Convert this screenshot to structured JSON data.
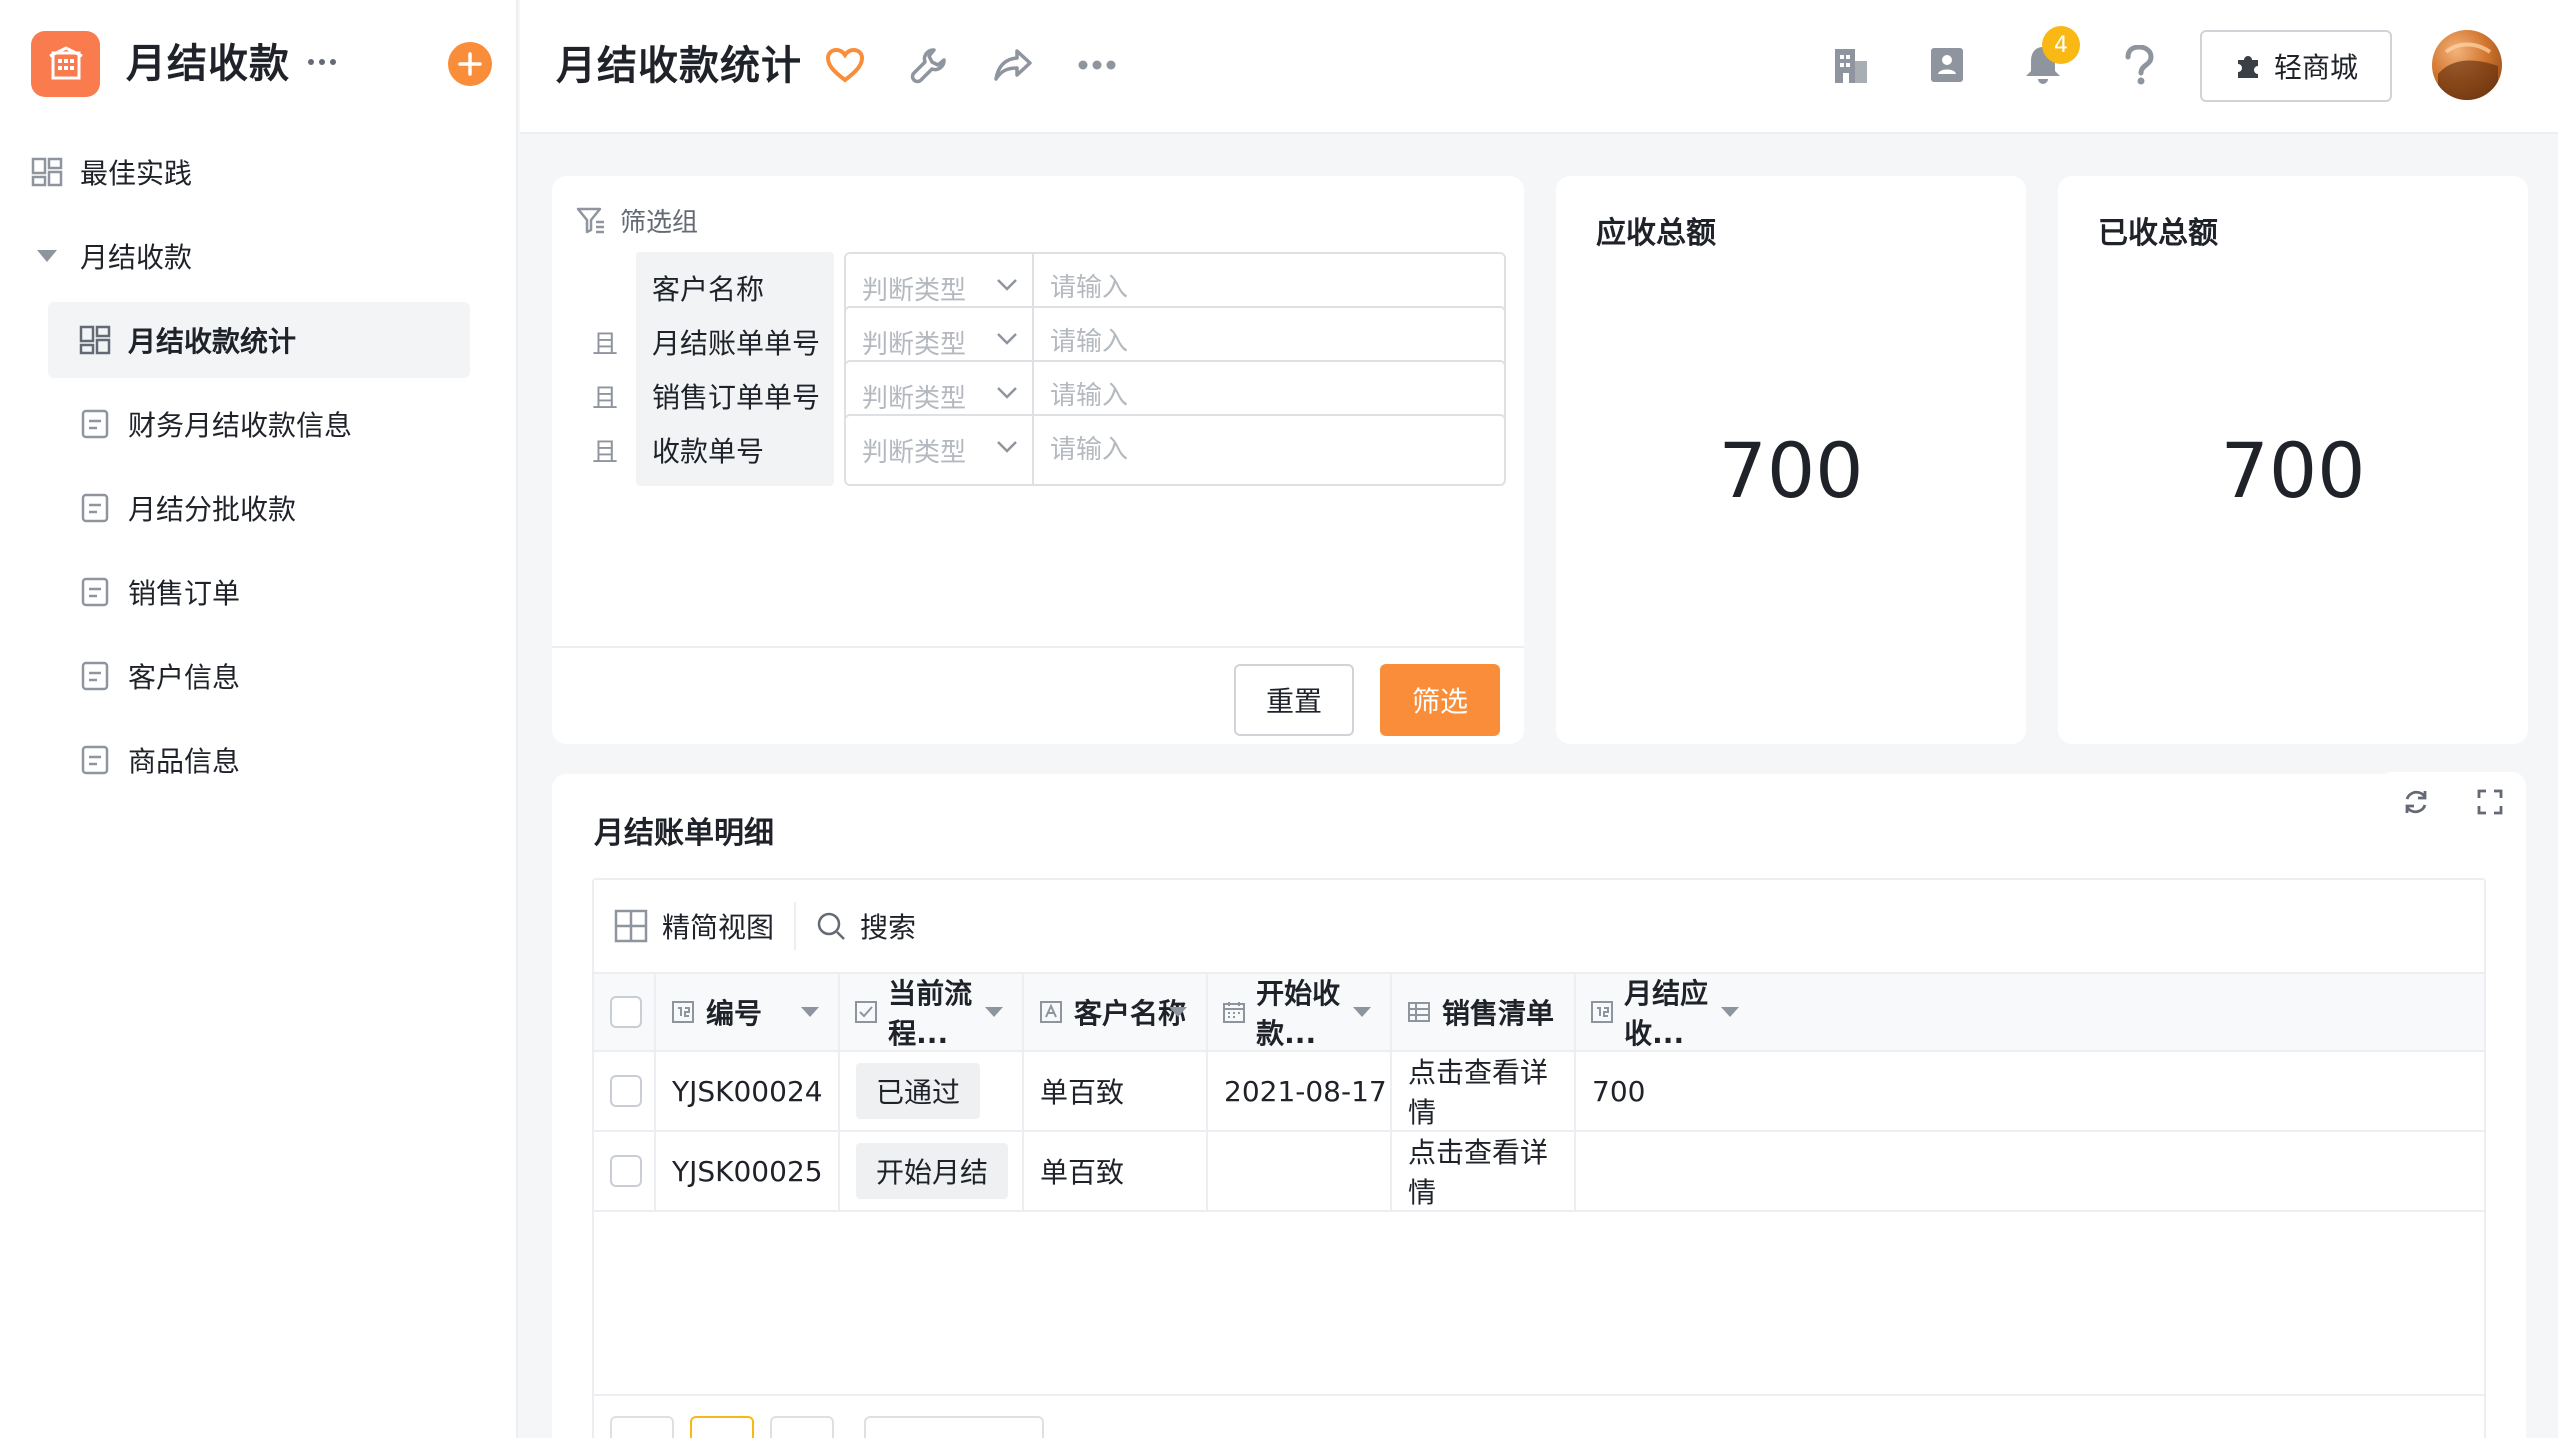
{
  "app": {
    "title": "月结收款",
    "logo_color": "#f97b4e",
    "accent": "#f98d3a"
  },
  "sidebar": {
    "items": [
      {
        "label": "最佳实践",
        "icon": "dashboard-icon"
      },
      {
        "label": "月结收款",
        "icon": "caret-down-icon"
      },
      {
        "label": "月结收款统计",
        "icon": "dashboard-icon",
        "active": true
      },
      {
        "label": "财务月结收款信息",
        "icon": "form-icon"
      },
      {
        "label": "月结分批收款",
        "icon": "form-icon"
      },
      {
        "label": "销售订单",
        "icon": "form-icon"
      },
      {
        "label": "客户信息",
        "icon": "form-icon"
      },
      {
        "label": "商品信息",
        "icon": "form-icon"
      }
    ]
  },
  "header": {
    "title": "月结收款统计",
    "notification_count": "4",
    "store_label": "轻商城"
  },
  "filter": {
    "group_label": "筛选组",
    "conjunction": "且",
    "type_placeholder": "判断类型",
    "input_placeholder": "请输入",
    "fields": [
      "客户名称",
      "月结账单单号",
      "销售订单单号",
      "收款单号"
    ],
    "reset_label": "重置",
    "submit_label": "筛选"
  },
  "stats": [
    {
      "label": "应收总额",
      "value": "700"
    },
    {
      "label": "已收总额",
      "value": "700"
    }
  ],
  "table": {
    "title": "月结账单明细",
    "view_label": "精简视图",
    "search_label": "搜索",
    "columns": [
      "编号",
      "当前流程...",
      "客户名称",
      "开始收款...",
      "销售清单",
      "月结应收..."
    ],
    "rows": [
      {
        "id": "YJSK00024",
        "status": "已通过",
        "customer": "单百致",
        "start": "2021-08-17",
        "sales": "点击查看详情",
        "amount": "700"
      },
      {
        "id": "YJSK00025",
        "status": "开始月结",
        "customer": "单百致",
        "start": "",
        "sales": "点击查看详情",
        "amount": ""
      }
    ]
  }
}
